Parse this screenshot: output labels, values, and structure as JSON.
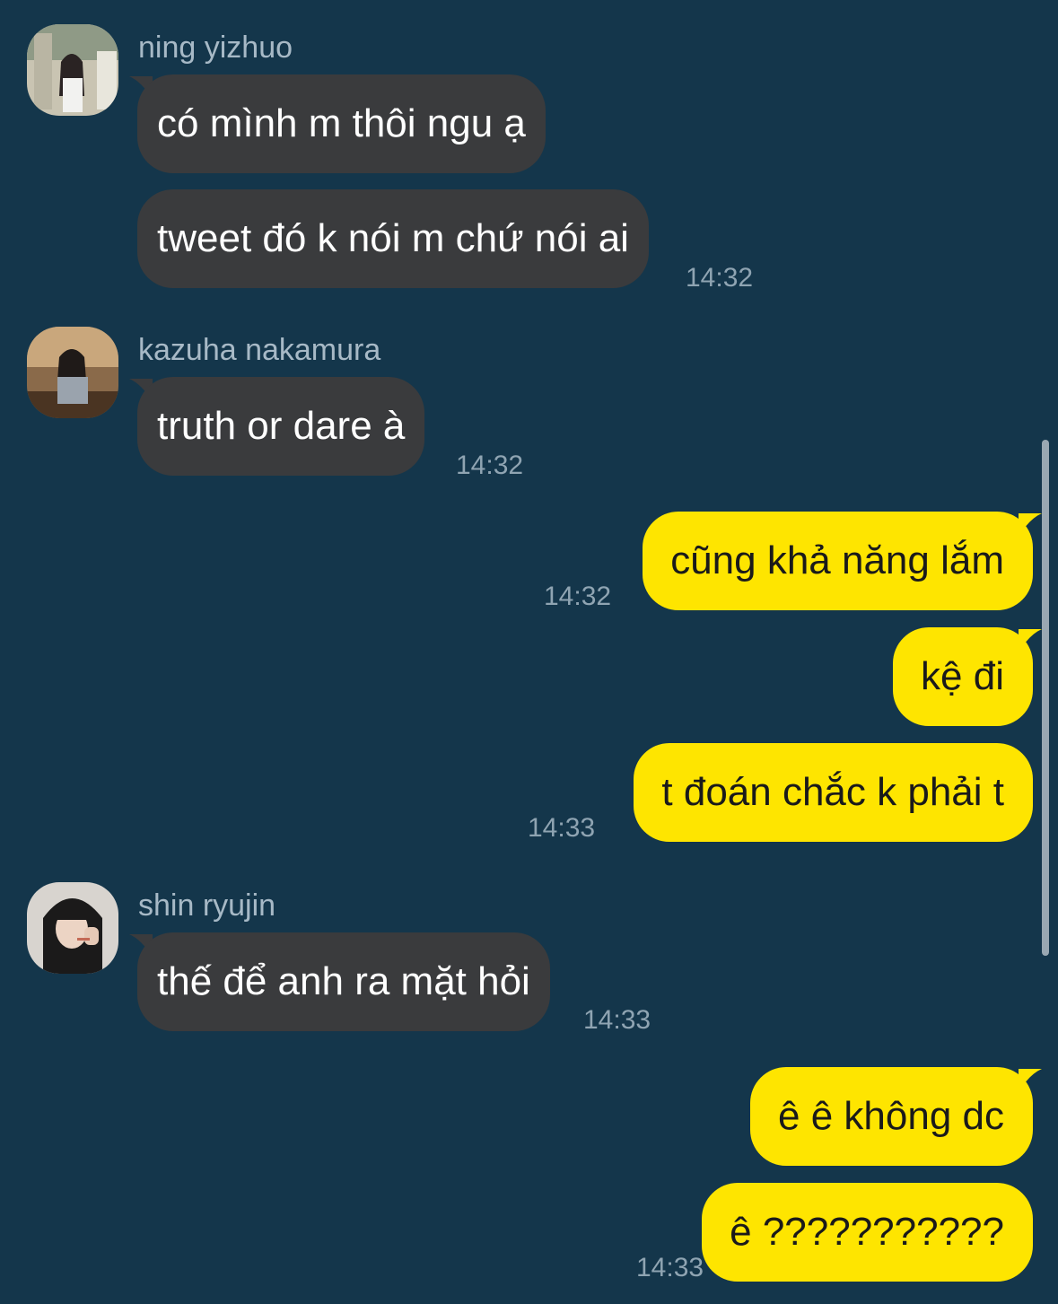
{
  "theme": {
    "background": "#14364b",
    "incoming_bubble": "#3a3b3d",
    "outgoing_bubble": "#fee500"
  },
  "messages": [
    {
      "sender": "ning yizhuo",
      "avatar": "profile-photo",
      "bubbles": [
        "có mình m thôi ngu ạ",
        "tweet đó k nói m chứ nói ai"
      ],
      "time": "14:32"
    },
    {
      "sender": "kazuha nakamura",
      "avatar": "profile-photo",
      "bubbles": [
        "truth or dare à"
      ],
      "time": "14:32"
    },
    {
      "sender": "me",
      "bubbles": [
        "cũng khả năng lắm"
      ],
      "time": "14:32"
    },
    {
      "sender": "me",
      "bubbles": [
        "kệ đi",
        "t đoán chắc k phải t"
      ],
      "time": "14:33"
    },
    {
      "sender": "shin ryujin",
      "avatar": "profile-photo",
      "bubbles": [
        "thế để anh ra mặt hỏi"
      ],
      "time": "14:33"
    },
    {
      "sender": "me",
      "bubbles": [
        "ê ê không dc",
        "ê ???????????"
      ],
      "time": "14:33"
    }
  ]
}
